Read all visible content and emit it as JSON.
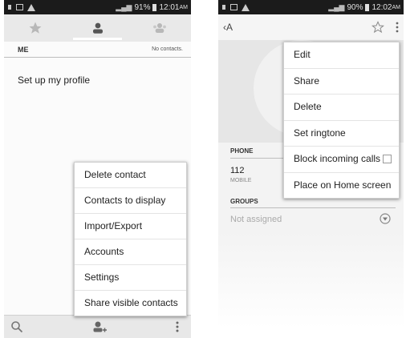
{
  "left": {
    "status": {
      "battery": "91%",
      "time": "12:01",
      "ampm": "AM"
    },
    "section": {
      "title": "ME",
      "note": "No contacts."
    },
    "profile_text": "Set up my profile",
    "overflow_menu": [
      "Delete contact",
      "Contacts to display",
      "Import/Export",
      "Accounts",
      "Settings",
      "Share visible contacts"
    ]
  },
  "right": {
    "status": {
      "battery": "90%",
      "time": "12:02",
      "ampm": "AM"
    },
    "contact_name": "A",
    "phone_section": "PHONE",
    "phone_number": "112",
    "phone_type": "MOBILE",
    "groups_section": "GROUPS",
    "groups_value": "Not assigned",
    "overflow_menu": {
      "edit": "Edit",
      "share": "Share",
      "delete": "Delete",
      "ringtone": "Set ringtone",
      "block": "Block incoming calls",
      "home": "Place on Home screen"
    }
  },
  "colors": {
    "status_bar": "#1b1b1b",
    "tab_bar": "#e9e9e9",
    "menu_bg": "#ffffff"
  }
}
